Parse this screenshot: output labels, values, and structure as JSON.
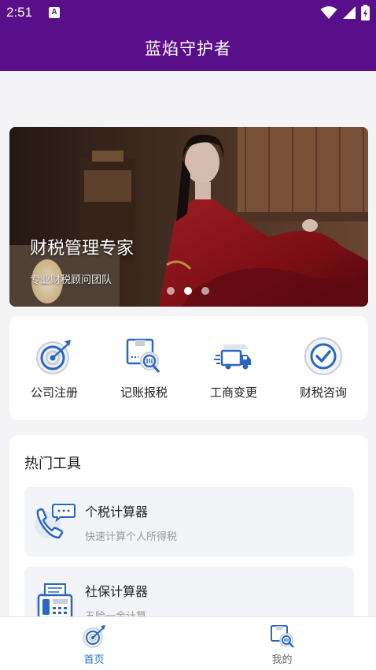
{
  "status_bar": {
    "time": "2:51",
    "notification_icon": "a-letter-icon",
    "icons": [
      "wifi-icon",
      "signal-icon",
      "battery-icon"
    ]
  },
  "app_bar": {
    "title": "蓝焰守护者",
    "background": "#5a0f8a"
  },
  "banner": {
    "title": "财税管理专家",
    "subtitle": "专业财税顾问团队",
    "active_slide": 2,
    "slide_count": 3
  },
  "services": [
    {
      "label": "公司注册",
      "icon": "target-icon"
    },
    {
      "label": "记账报税",
      "icon": "document-search-icon"
    },
    {
      "label": "工商变更",
      "icon": "delivery-truck-icon"
    },
    {
      "label": "财税咨询",
      "icon": "check-circle-icon"
    }
  ],
  "hot_tools": {
    "title": "热门工具",
    "items": [
      {
        "name": "个税计算器",
        "desc": "快速计算个人所得税",
        "icon": "phone-chat-icon"
      },
      {
        "name": "社保计算器",
        "desc": "五险一金计算",
        "icon": "fax-machine-icon"
      }
    ]
  },
  "bottom_nav": [
    {
      "label": "首页",
      "icon": "home-target-icon",
      "active": true
    },
    {
      "label": "我的",
      "icon": "profile-search-icon",
      "active": false
    }
  ],
  "colors": {
    "brand": "#5a0f8a",
    "accent": "#1e6fd6",
    "icon_blue": "#2a66c4"
  }
}
